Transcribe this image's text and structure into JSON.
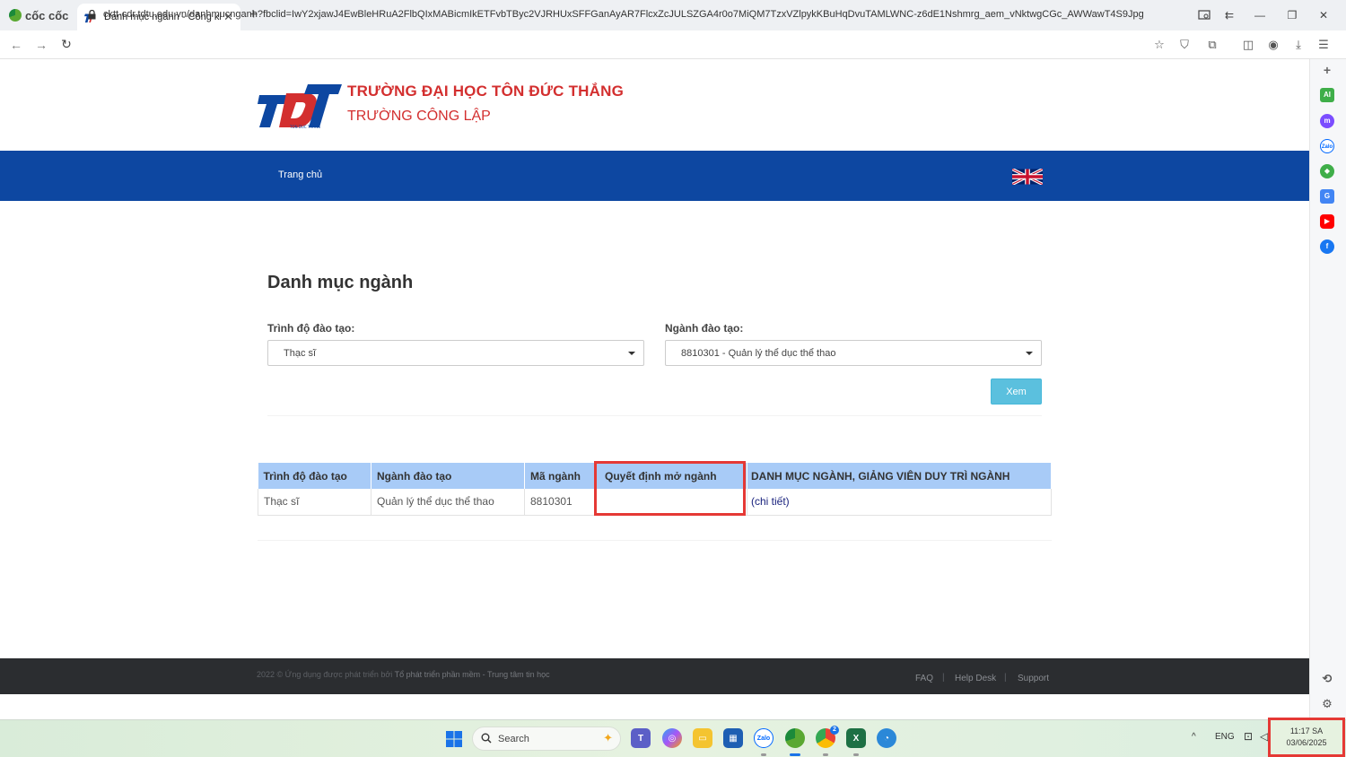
{
  "browser": {
    "brand": "cốc cốc",
    "tab_title": "Danh mục ngành - Công kha",
    "url": "cktt-cdr.tdtu.edu.vn/danhmucnganh?fbclid=IwY2xjawJ4EwBleHRuA2FlbQIxMABicmIkETFvbTByc2VJRHUxSFFGanAyAR7FlcxZcJULSZGA4r0o7MiQM7TzxVZlpykKBuHqDvuTAMLWNC-z6dE1Nshmrg_aem_vNktwgCGc_AWWawT4S9Jpg"
  },
  "header": {
    "university_name": "TRƯỜNG ĐẠI HỌC TÔN ĐỨC THẮNG",
    "subtitle": "TRƯỜNG CÔNG LẬP"
  },
  "nav": {
    "home": "Trang chủ"
  },
  "main": {
    "title": "Danh mục ngành",
    "level_label": "Trình độ đào tạo:",
    "level_value": "Thạc sĩ",
    "major_label": "Ngành đào tạo:",
    "major_value": "8810301 - Quản lý thể dục thể thao",
    "view_button": "Xem"
  },
  "table": {
    "headers": [
      "Trình độ đào tạo",
      "Ngành đào tạo",
      "Mã ngành",
      "Quyết định mở ngành",
      "DANH MỤC NGÀNH, GIẢNG VIÊN DUY TRÌ NGÀNH"
    ],
    "rows": [
      [
        "Thạc sĩ",
        "Quản lý thể dục thể thao",
        "8810301",
        "",
        "(chi tiết)"
      ]
    ]
  },
  "footer": {
    "copyright": "2022 © Ứng dụng được phát triển bởi ",
    "developer": "Tổ phát triển phần mềm - Trung tâm tin học",
    "links": [
      "FAQ",
      "Help Desk",
      "Support"
    ],
    "separator": "|"
  },
  "taskbar": {
    "search_placeholder": "Search",
    "language": "ENG",
    "time": "11:17 SA",
    "date": "03/06/2025",
    "chrome_badge": "2"
  },
  "colors": {
    "navbar": "#0d47a1",
    "university_red": "#d32f2f",
    "table_header": "#a8cbf7",
    "button": "#5bc0de",
    "highlight": "#e53935"
  }
}
